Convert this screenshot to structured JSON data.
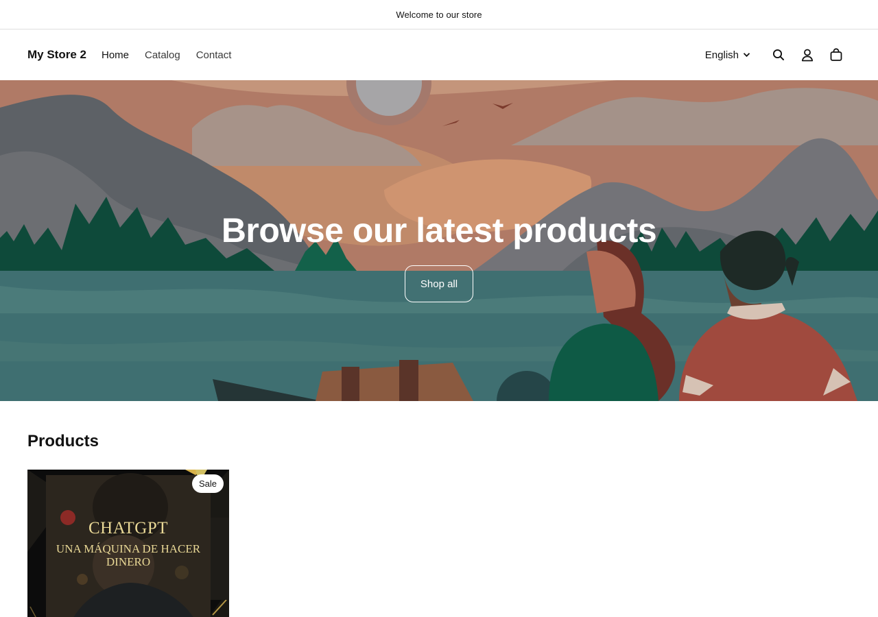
{
  "announcement": {
    "text": "Welcome to our store"
  },
  "header": {
    "logo": "My Store 2",
    "nav": [
      {
        "label": "Home",
        "active": true
      },
      {
        "label": "Catalog",
        "active": false
      },
      {
        "label": "Contact",
        "active": false
      }
    ],
    "language": "English",
    "icons": [
      "search-icon",
      "account-icon",
      "cart-icon"
    ]
  },
  "hero": {
    "title": "Browse our latest products",
    "button_label": "Shop all"
  },
  "products": {
    "heading": "Products",
    "items": [
      {
        "image_title": "CHATGPT",
        "image_subtitle": "UNA MÁQUINA DE HACER DINERO",
        "badge": "Sale"
      }
    ]
  },
  "colors": {
    "text": "#121212",
    "hero_water": "#3f6f71",
    "hero_sky": "#b47a64",
    "card_gold": "#e9d896"
  }
}
